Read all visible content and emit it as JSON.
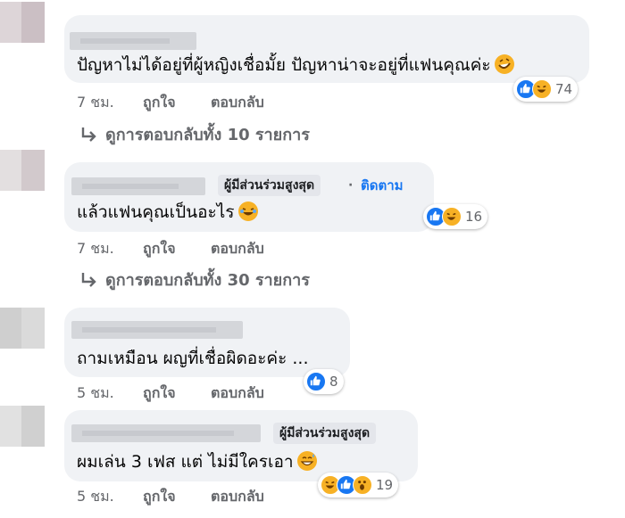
{
  "comments": [
    {
      "text": "ปัญหาไม่ได้อยู่ที่ผู้หญิงเชื่อมั้ย ปัญหาน่าจะอยู่ที่แฟนคุณค่ะ",
      "reaction_count": "74",
      "reaction_icons": [
        "like-icon",
        "haha-icon"
      ],
      "time": "7 ชม.",
      "like_label": "ถูกใจ",
      "reply_label": "ตอบกลับ",
      "view_replies": "ดูการตอบกลับทั้ง 10 รายการ"
    },
    {
      "badge": "ผู้มีส่วนร่วมสูงสุด",
      "separator": "·",
      "follow": "ติดตาม",
      "text": "แล้วแฟนคุณเป็นอะไร",
      "reaction_count": "16",
      "reaction_icons": [
        "like-icon",
        "haha-icon"
      ],
      "time": "7 ชม.",
      "like_label": "ถูกใจ",
      "reply_label": "ตอบกลับ",
      "view_replies": "ดูการตอบกลับทั้ง 30 รายการ"
    },
    {
      "text": "ถามเหมือน ผญที่เชื่อผิดอะค่ะ ...",
      "reaction_count": "8",
      "reaction_icons": [
        "like-icon"
      ],
      "time": "5 ชม.",
      "like_label": "ถูกใจ",
      "reply_label": "ตอบกลับ"
    },
    {
      "badge": "ผู้มีส่วนร่วมสูงสุด",
      "text": "ผมเล่น 3 เฟส แต่ ไม่มีใครเอา",
      "reaction_count": "19",
      "reaction_icons": [
        "haha-icon",
        "like-icon",
        "wow-icon"
      ],
      "time": "5 ชม.",
      "like_label": "ถูกใจ",
      "reply_label": "ตอบกลับ"
    }
  ],
  "colors": {
    "bubble": "#f0f2f5",
    "like": "#1877f2",
    "haha": "#f7b125",
    "meta_text": "#65676b"
  }
}
